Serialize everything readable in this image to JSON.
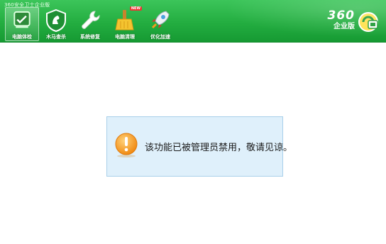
{
  "app": {
    "title": "360安全卫士企业版"
  },
  "nav": {
    "items": [
      {
        "label": "电脑体检",
        "icon": "computer-check-icon",
        "active": true
      },
      {
        "label": "木马查杀",
        "icon": "horse-shield-icon",
        "active": false
      },
      {
        "label": "系统修复",
        "icon": "wrench-icon",
        "active": false
      },
      {
        "label": "电脑清理",
        "icon": "broom-icon",
        "active": false,
        "badge": "NEW"
      },
      {
        "label": "优化加速",
        "icon": "rocket-icon",
        "active": false
      }
    ]
  },
  "brand": {
    "number": "360",
    "edition": "企业版",
    "logo": "360-logo-icon"
  },
  "notice": {
    "icon": "warning-icon",
    "message": "该功能已被管理员禁用，敬请见谅。"
  },
  "colors": {
    "header_green": "#23ad40",
    "notice_bg": "#dff0fb",
    "notice_border": "#a9d0ea",
    "warning_orange": "#f39a1e"
  }
}
